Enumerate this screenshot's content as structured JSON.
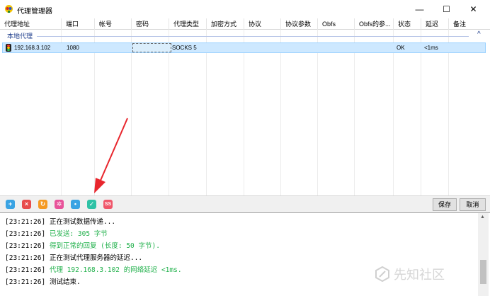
{
  "window": {
    "title": "代理管理器",
    "controls": {
      "minimize": "—",
      "maximize": "☐",
      "close": "✕"
    }
  },
  "table": {
    "columns": [
      "代理地址",
      "端口",
      "帐号",
      "密码",
      "代理类型",
      "加密方式",
      "协议",
      "协议参数",
      "Obfs",
      "Obfs的参...",
      "状态",
      "延迟",
      "备注"
    ],
    "group_label": "本地代理",
    "rows": [
      {
        "address": "192.168.3.102",
        "port": "1080",
        "account": "",
        "password": "",
        "type": "SOCKS 5",
        "encryption": "",
        "protocol": "",
        "protocol_params": "",
        "obfs": "",
        "obfs_params": "",
        "status": "OK",
        "latency": "<1ms",
        "note": ""
      }
    ]
  },
  "toolbar": {
    "icons": [
      "add-icon",
      "delete-icon",
      "refresh-icon",
      "settings-icon",
      "bulb-icon",
      "check-icon",
      "ss-icon"
    ],
    "save_label": "保存",
    "cancel_label": "取消"
  },
  "log": {
    "lines": [
      {
        "time": "[23:21:26]",
        "text": "正在测试数据传递...",
        "color": "#000000"
      },
      {
        "time": "[23:21:26]",
        "text": "已发送: 305 字节",
        "color": "#22b14c"
      },
      {
        "time": "[23:21:26]",
        "text": "得到正常的回复 (长度: 50 字节).",
        "color": "#22b14c"
      },
      {
        "time": "[23:21:26]",
        "text": "正在测试代理服务器的延迟...",
        "color": "#000000"
      },
      {
        "time": "[23:21:26]",
        "text": "代理 192.168.3.102 的网络延迟 <1ms.",
        "color": "#22b14c"
      },
      {
        "time": "[23:21:26]",
        "text": "测试结束.",
        "color": "#000000"
      }
    ]
  },
  "watermark": "先知社区",
  "colors": {
    "selection": "#cde8ff",
    "group_text": "#1a3a8a",
    "log_green": "#22b14c",
    "annotation_arrow": "#e8262d"
  }
}
